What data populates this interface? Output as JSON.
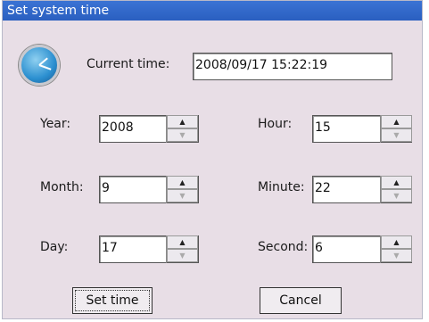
{
  "window": {
    "title": "Set system time"
  },
  "current_time": {
    "label": "Current time:",
    "value": "2008/09/17 15:22:19"
  },
  "fields": {
    "year": {
      "label": "Year:",
      "value": "2008"
    },
    "month": {
      "label": "Month:",
      "value": "9"
    },
    "day": {
      "label": "Day:",
      "value": "17"
    },
    "hour": {
      "label": "Hour:",
      "value": "15"
    },
    "minute": {
      "label": "Minute:",
      "value": "22"
    },
    "second": {
      "label": "Second:",
      "value": "6"
    }
  },
  "spinner": {
    "up_glyph": "▲",
    "down_glyph": "▼"
  },
  "buttons": {
    "set_time": "Set time",
    "cancel": "Cancel"
  },
  "icons": {
    "clock": "clock-icon"
  }
}
